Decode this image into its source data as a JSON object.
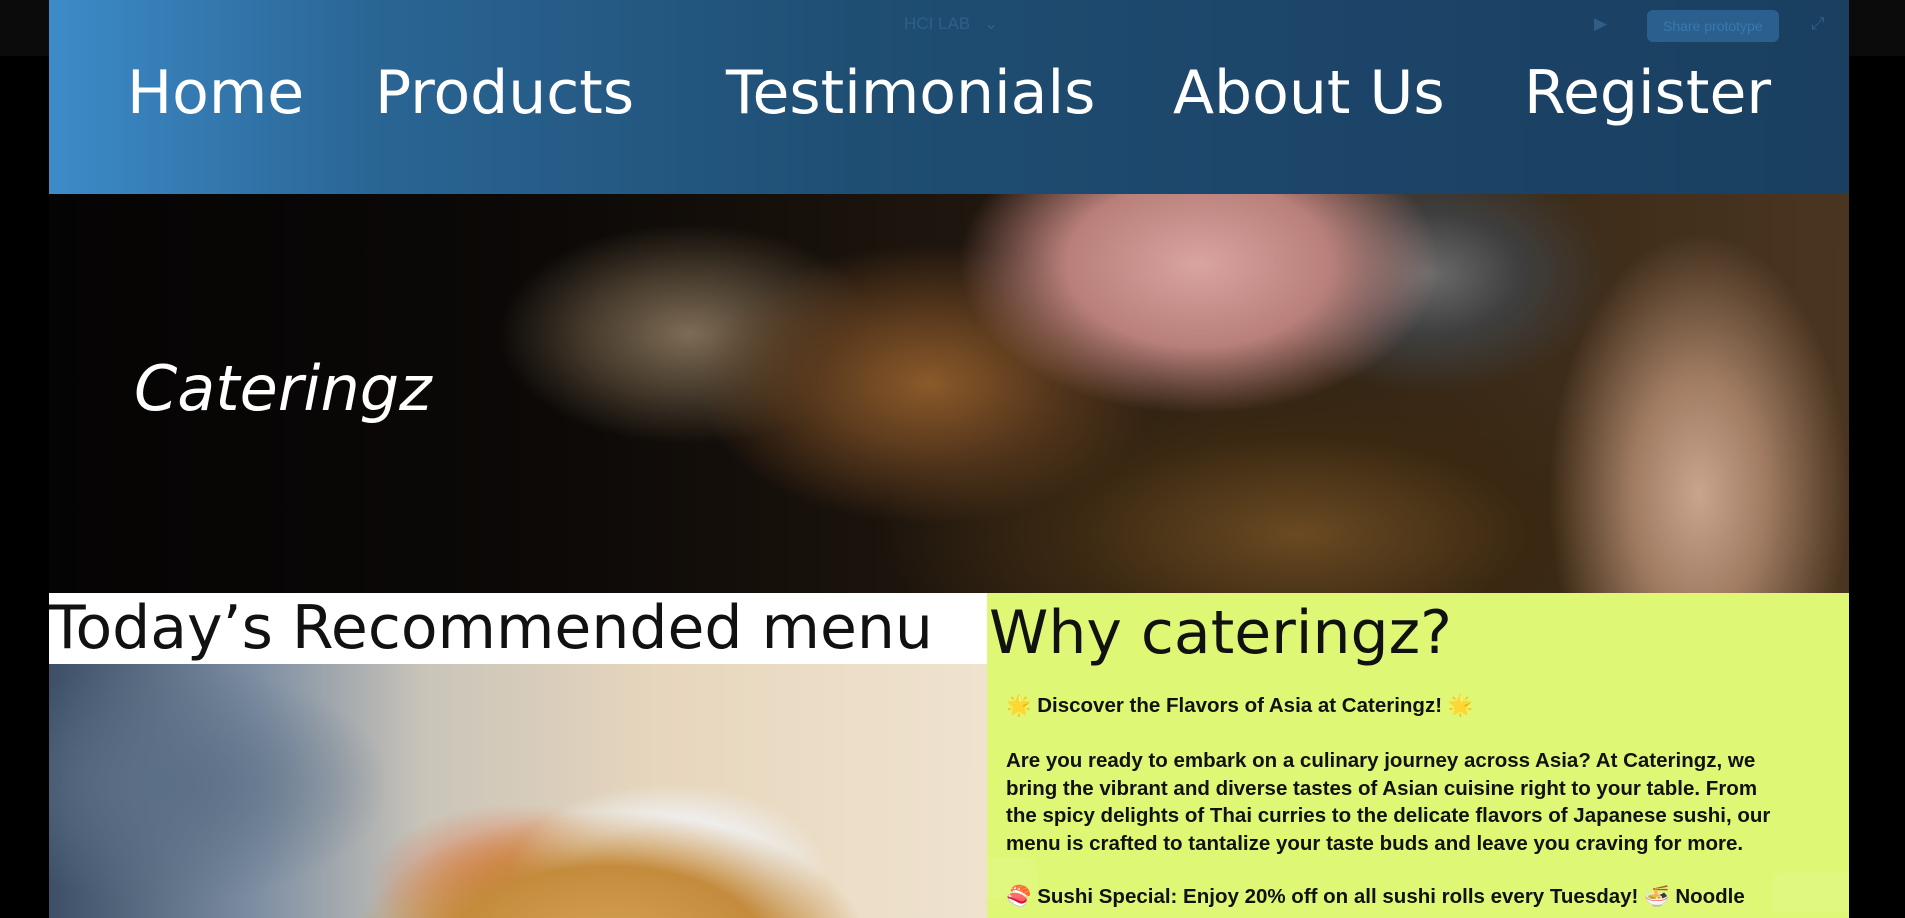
{
  "toolbar": {
    "title": "HCI LAB",
    "share_label": "Share prototype",
    "icons": [
      "sidebar-toggle-icon",
      "comment-icon",
      "chevron-down-icon",
      "play-icon",
      "expand-icon"
    ]
  },
  "nav": {
    "items": [
      "Home",
      "Products",
      "Testimonials",
      "About Us",
      "Register"
    ]
  },
  "hero": {
    "title": "Cateringz"
  },
  "menu": {
    "title": "Today’s Recommended menu"
  },
  "why": {
    "title": "Why cateringz?",
    "headline_emoji": "🌟",
    "headline": "Discover the Flavors of Asia at Cateringz!",
    "paragraph_lines": [
      "Are you ready to embark on a culinary journey across Asia? At Cateringz, we",
      "bring the vibrant and diverse tastes of Asian cuisine right to your table. From",
      "the spicy delights of Thai curries to the delicate flavors of Japanese sushi, our",
      "menu is crafted to tantalize your taste buds and leave you craving for more."
    ],
    "special_emoji": "🍣",
    "special": "Sushi Special: Enjoy 20% off on all sushi rolls every Tuesday!",
    "special_tail_emoji": "🍜",
    "special_tail": "Noodle"
  },
  "colors": {
    "nav_start": "#3d8bc9",
    "nav_end": "#1a3f60",
    "why_bg": "#def876",
    "page_bg": "#000000"
  }
}
